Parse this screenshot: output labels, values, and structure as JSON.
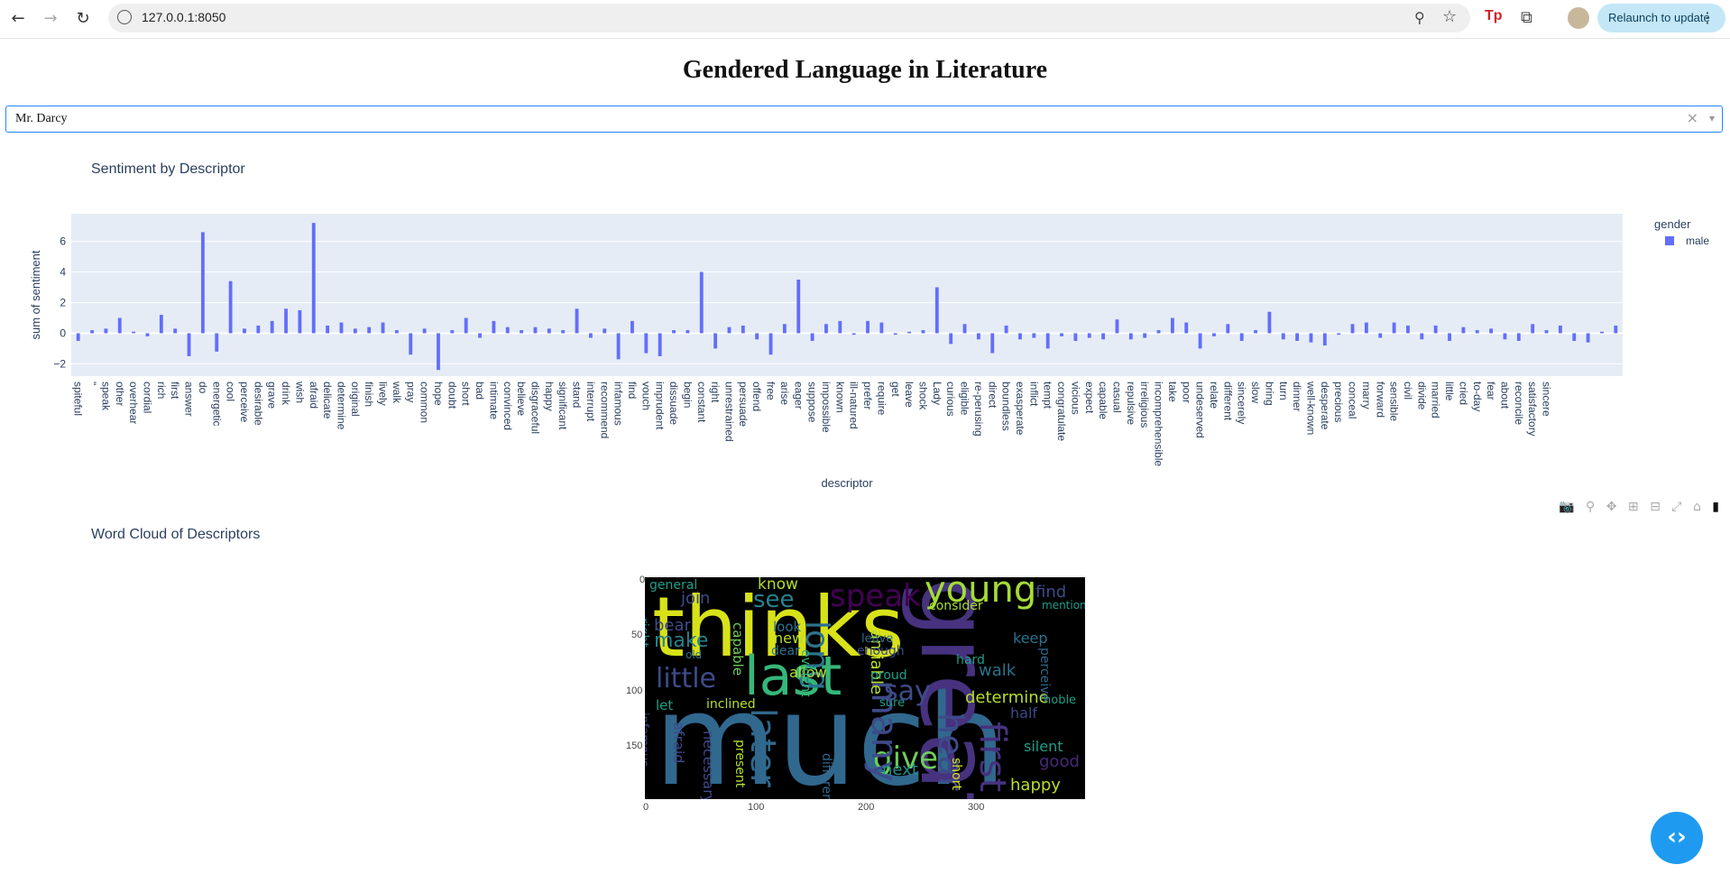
{
  "browser": {
    "url": "127.0.0.1:8050",
    "relaunch_label": "Relaunch to update",
    "back_icon": "←",
    "forward_icon": "→",
    "reload_icon": "↻",
    "zoom_icon": "⚲",
    "star_icon": "☆",
    "tp_icon": "Tp",
    "ext_icon": "⧉",
    "menu_icon": "⋮"
  },
  "page": {
    "title": "Gendered Language in Literature"
  },
  "character_select": {
    "value": "Mr. Darcy",
    "clear_icon": "×",
    "caret_icon": "▾"
  },
  "chart_data": {
    "type": "bar",
    "title": "Sentiment by Descriptor",
    "xlabel": "descriptor",
    "ylabel": "sum of sentiment",
    "ylim": [
      -2.8,
      7.8
    ],
    "yticks": [
      "6",
      "4",
      "2",
      "0",
      "−2"
    ],
    "legend_title": "gender",
    "legend_position": "top-right",
    "grid": true,
    "background": "#e5ecf6",
    "bar_color": "#636efa",
    "series": [
      {
        "name": "male",
        "values": [
          -0.5,
          0.2,
          0.3,
          1.0,
          0.1,
          -0.2,
          1.2,
          0.3,
          -1.5,
          6.6,
          -1.2,
          3.4,
          0.3,
          0.5,
          0.8,
          1.6,
          1.5,
          7.2,
          0.5,
          0.7,
          0.3,
          0.4,
          0.7,
          0.2,
          -1.4,
          0.3,
          -2.4,
          0.2,
          1.0,
          -0.3,
          0.8,
          0.4,
          0.2,
          0.4,
          0.3,
          0.2,
          1.6,
          -0.3,
          0.3,
          -1.7,
          0.8,
          -1.3,
          -1.5,
          0.2,
          0.2,
          4.0,
          -1.0,
          0.4,
          0.5,
          -0.4,
          -1.4,
          0.6,
          3.5,
          -0.5,
          0.6,
          0.8,
          -0.1,
          0.8,
          0.7,
          -0.1,
          0.1,
          0.2,
          3.0,
          -0.7,
          0.6,
          -0.4,
          -1.3,
          0.5,
          -0.4,
          -0.3,
          -1.0,
          -0.2,
          -0.5,
          -0.3,
          -0.4,
          0.9,
          -0.4,
          -0.3,
          0.2,
          1.0,
          0.7,
          -1.0,
          -0.2,
          0.6,
          -0.5,
          0.2,
          1.4,
          -0.4,
          -0.5,
          -0.6,
          -0.8,
          -0.1,
          0.6,
          0.7,
          -0.3,
          0.7,
          0.5,
          -0.4,
          0.5,
          -0.5,
          0.4,
          0.2,
          0.3,
          -0.4,
          -0.5,
          0.6,
          0.2,
          0.5,
          -0.5,
          -0.6,
          0.1,
          0.5
        ]
      }
    ],
    "categories": [
      "spiteful",
      "\"",
      "speak",
      "other",
      "overhear",
      "cordial",
      "rich",
      "first",
      "answer",
      "do",
      "energetic",
      "cool",
      "perceive",
      "desirable",
      "grave",
      "drink",
      "wish",
      "afraid",
      "delicate",
      "determine",
      "original",
      "finish",
      "lively",
      "walk",
      "pray",
      "common",
      "hope",
      "doubt",
      "short",
      "bad",
      "intimate",
      "convinced",
      "believe",
      "disgraceful",
      "happy",
      "significant",
      "stand",
      "interrupt",
      "recommend",
      "infamous",
      "find",
      "vouch",
      "imprudent",
      "dissuade",
      "begin",
      "constant",
      "right",
      "unrestrained",
      "persuade",
      "offend",
      "free",
      "arise",
      "eager",
      "suppose",
      "impossible",
      "known",
      "ill-natured",
      "prefer",
      "require",
      "get",
      "leave",
      "shock",
      "Lady",
      "curious",
      "eligible",
      "re-perusing",
      "direct",
      "boundless",
      "exasperate",
      "inflict",
      "tempt",
      "congratulate",
      "vicious",
      "expect",
      "capable",
      "casual",
      "repulsive",
      "irreligious",
      "incomprehensible",
      "take",
      "poor",
      "undeserved",
      "relate",
      "different",
      "sincerely",
      "slow",
      "bring",
      "turn",
      "dinner",
      "well-known",
      "desperate",
      "precious",
      "conceal",
      "marry",
      "forward",
      "sensible",
      "civil",
      "divide",
      "married",
      "little",
      "cried",
      "to-day",
      "fear",
      "about",
      "reconcile",
      "satisfactory",
      "sincere"
    ]
  },
  "wordcloud": {
    "title": "Word Cloud of Descriptors",
    "y_ticks": [
      "0",
      "50",
      "100",
      "150"
    ],
    "x_ticks": [
      "0",
      "100",
      "200",
      "300"
    ],
    "words": [
      {
        "text": "thinks",
        "color": "#d8e219"
      },
      {
        "text": "much",
        "color": "#31688e"
      },
      {
        "text": "great",
        "color": "#46327e"
      },
      {
        "text": "young",
        "color": "#a5db36"
      },
      {
        "text": "last",
        "color": "#35b779"
      },
      {
        "text": "speak",
        "color": "#440154"
      },
      {
        "text": "little",
        "color": "#3e4a89"
      },
      {
        "text": "hear",
        "color": "#3e4a89"
      },
      {
        "text": "first",
        "color": "#46327e"
      },
      {
        "text": "give",
        "color": "#6ece58"
      },
      {
        "text": "see",
        "color": "#26828e"
      },
      {
        "text": "say",
        "color": "#3e4a89"
      },
      {
        "text": "many",
        "color": "#3e4a89"
      },
      {
        "text": "later",
        "color": "#31688e"
      },
      {
        "text": "determine",
        "color": "#b5de2b"
      },
      {
        "text": "happy",
        "color": "#b5de2b"
      },
      {
        "text": "good",
        "color": "#482878"
      },
      {
        "text": "long",
        "color": "#2c728e"
      },
      {
        "text": "find",
        "color": "#3e4a89"
      },
      {
        "text": "know",
        "color": "#b5de2b"
      },
      {
        "text": "make",
        "color": "#26828e"
      },
      {
        "text": "bear",
        "color": "#3e4a89"
      },
      {
        "text": "join",
        "color": "#3e4a89"
      },
      {
        "text": "general",
        "color": "#1f9e89"
      },
      {
        "text": "new",
        "color": "#b5de2b"
      },
      {
        "text": "look",
        "color": "#2c728e"
      },
      {
        "text": "dear",
        "color": "#2c728e"
      },
      {
        "text": "allow",
        "color": "#b5de2b"
      },
      {
        "text": "amiable",
        "color": "#b5de2b"
      },
      {
        "text": "next",
        "color": "#21918c"
      },
      {
        "text": "half",
        "color": "#3e4a89"
      },
      {
        "text": "keep",
        "color": "#2c728e"
      },
      {
        "text": "walk",
        "color": "#2c728e"
      },
      {
        "text": "consider",
        "color": "#a5db36"
      },
      {
        "text": "silent",
        "color": "#1f9e89"
      },
      {
        "text": "noble",
        "color": "#1f9e89"
      },
      {
        "text": "perceive",
        "color": "#31688e"
      },
      {
        "text": "afraid",
        "color": "#3e4a89"
      },
      {
        "text": "necessary",
        "color": "#3e4a89"
      },
      {
        "text": "present",
        "color": "#b5de2b"
      },
      {
        "text": "different",
        "color": "#31688e"
      },
      {
        "text": "short",
        "color": "#d8e219"
      },
      {
        "text": "evident",
        "color": "#35b779"
      },
      {
        "text": "capable",
        "color": "#6ece58"
      },
      {
        "text": "enough",
        "color": "#3e4a89"
      },
      {
        "text": "proud",
        "color": "#1f9e89"
      },
      {
        "text": "sure",
        "color": "#1f9e89"
      },
      {
        "text": "let",
        "color": "#1f9e89"
      },
      {
        "text": "inclined",
        "color": "#b5de2b"
      },
      {
        "text": "right",
        "color": "#26828e"
      },
      {
        "text": "infamous",
        "color": "#3e4a89"
      },
      {
        "text": "mention",
        "color": "#1f9e89"
      },
      {
        "text": "hard",
        "color": "#1f9e89"
      },
      {
        "text": "leave",
        "color": "#2c728e"
      },
      {
        "text": "old",
        "color": "#2c728e"
      }
    ]
  },
  "modebar": {
    "camera_icon": "📷",
    "zoom_icon": "⚲",
    "pan_icon": "✥",
    "zoom_in_icon": "⊞",
    "zoom_out_icon": "⊟",
    "autoscale_icon": "⤢",
    "reset_icon": "⌂",
    "logo_icon": "▮"
  },
  "fab": {
    "icon": "‹›"
  }
}
